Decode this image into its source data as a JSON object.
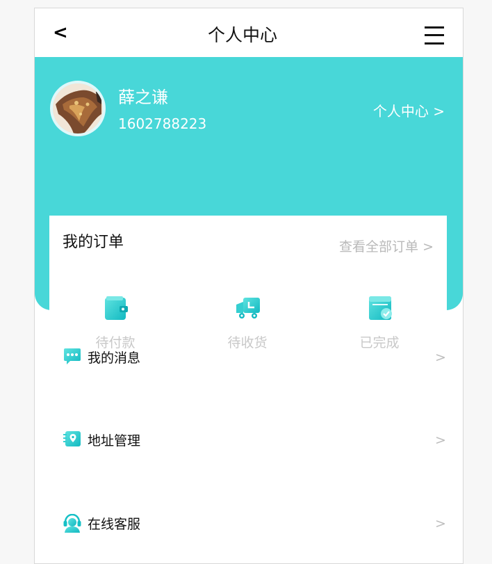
{
  "colors": {
    "accent": "#48d7d8",
    "accent_dark": "#16c0c6",
    "muted": "#c8c8c8"
  },
  "header": {
    "back_label": "<",
    "title": "个人中心",
    "menu_icon": "hamburger-menu-icon"
  },
  "profile": {
    "name": "薛之谦",
    "phone": "1602788223",
    "center_link": "个人中心 >"
  },
  "orders": {
    "title": "我的订单",
    "view_all": "查看全部订单 >",
    "items": [
      {
        "label": "待付款",
        "icon": "wallet-icon"
      },
      {
        "label": "待收货",
        "icon": "truck-icon"
      },
      {
        "label": "已完成",
        "icon": "box-check-icon"
      }
    ]
  },
  "menu": [
    {
      "label": "我的消息",
      "icon": "chat-bubble-icon",
      "arrow": ">"
    },
    {
      "label": "地址管理",
      "icon": "address-book-icon",
      "arrow": ">"
    },
    {
      "label": "在线客服",
      "icon": "headset-icon",
      "arrow": ">"
    }
  ]
}
